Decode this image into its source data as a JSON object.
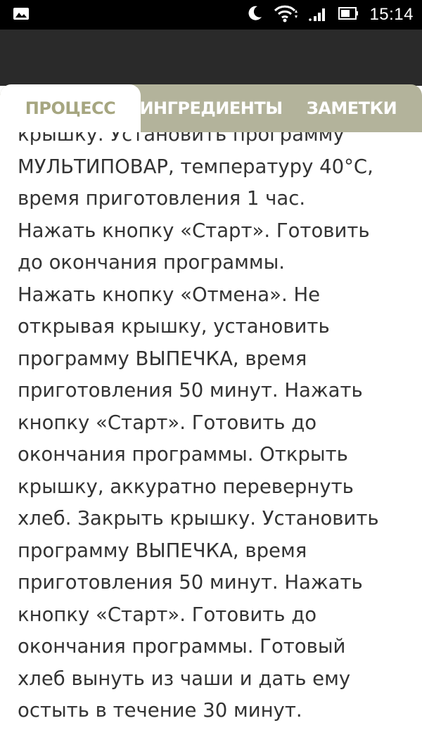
{
  "status_bar": {
    "time": "15:14",
    "icons": [
      "image-notification-icon",
      "moon-icon",
      "wifi-icon",
      "cell-signal-icon",
      "battery-icon"
    ]
  },
  "tabs": [
    {
      "label": "ПРОЦЕСС",
      "active": true
    },
    {
      "label": "ИНГРЕДИЕНТЫ",
      "active": false
    },
    {
      "label": "ЗАМЕТКИ",
      "active": false
    }
  ],
  "content": {
    "text": "крышку. Установить программу\nМУЛЬТИПОВАР, температуру 40°С,\nвремя приготовления 1 час.\nНажать кнопку «Старт». Готовить\nдо окончания программы.\nНажать кнопку «Отмена». Не\nоткрывая крышку, установить\nпрограмму ВЫПЕЧКА, время\nприготовления 50 минут. Нажать\nкнопку «Старт». Готовить до\nокончания программы. Открыть\nкрышку, аккуратно перевернуть\nхлеб. Закрыть крышку. Установить\nпрограмму ВЫПЕЧКА, время\nприготовления 50 минут. Нажать\nкнопку «Старт». Готовить до\nокончания программы. Готовый\nхлеб вынуть из чаши и дать ему\nостыть в течение 30 минут."
  },
  "colors": {
    "status_bar_bg": "#000000",
    "app_bar_bg": "#2a2a2a",
    "tab_bar_bg": "#b3b39b",
    "active_tab_text": "#a6a680",
    "inactive_tab_text": "#ffffff",
    "body_text": "#333333"
  }
}
